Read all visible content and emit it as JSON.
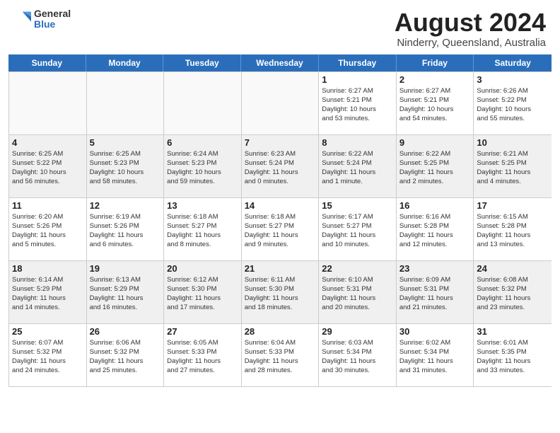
{
  "header": {
    "logo_general": "General",
    "logo_blue": "Blue",
    "main_title": "August 2024",
    "subtitle": "Ninderry, Queensland, Australia"
  },
  "days_of_week": [
    "Sunday",
    "Monday",
    "Tuesday",
    "Wednesday",
    "Thursday",
    "Friday",
    "Saturday"
  ],
  "weeks": [
    [
      {
        "day": "",
        "info": "",
        "empty": true
      },
      {
        "day": "",
        "info": "",
        "empty": true
      },
      {
        "day": "",
        "info": "",
        "empty": true
      },
      {
        "day": "",
        "info": "",
        "empty": true
      },
      {
        "day": "1",
        "info": "Sunrise: 6:27 AM\nSunset: 5:21 PM\nDaylight: 10 hours\nand 53 minutes."
      },
      {
        "day": "2",
        "info": "Sunrise: 6:27 AM\nSunset: 5:21 PM\nDaylight: 10 hours\nand 54 minutes."
      },
      {
        "day": "3",
        "info": "Sunrise: 6:26 AM\nSunset: 5:22 PM\nDaylight: 10 hours\nand 55 minutes."
      }
    ],
    [
      {
        "day": "4",
        "info": "Sunrise: 6:25 AM\nSunset: 5:22 PM\nDaylight: 10 hours\nand 56 minutes.",
        "alt": true
      },
      {
        "day": "5",
        "info": "Sunrise: 6:25 AM\nSunset: 5:23 PM\nDaylight: 10 hours\nand 58 minutes.",
        "alt": true
      },
      {
        "day": "6",
        "info": "Sunrise: 6:24 AM\nSunset: 5:23 PM\nDaylight: 10 hours\nand 59 minutes.",
        "alt": true
      },
      {
        "day": "7",
        "info": "Sunrise: 6:23 AM\nSunset: 5:24 PM\nDaylight: 11 hours\nand 0 minutes.",
        "alt": true
      },
      {
        "day": "8",
        "info": "Sunrise: 6:22 AM\nSunset: 5:24 PM\nDaylight: 11 hours\nand 1 minute.",
        "alt": true
      },
      {
        "day": "9",
        "info": "Sunrise: 6:22 AM\nSunset: 5:25 PM\nDaylight: 11 hours\nand 2 minutes.",
        "alt": true
      },
      {
        "day": "10",
        "info": "Sunrise: 6:21 AM\nSunset: 5:25 PM\nDaylight: 11 hours\nand 4 minutes.",
        "alt": true
      }
    ],
    [
      {
        "day": "11",
        "info": "Sunrise: 6:20 AM\nSunset: 5:26 PM\nDaylight: 11 hours\nand 5 minutes."
      },
      {
        "day": "12",
        "info": "Sunrise: 6:19 AM\nSunset: 5:26 PM\nDaylight: 11 hours\nand 6 minutes."
      },
      {
        "day": "13",
        "info": "Sunrise: 6:18 AM\nSunset: 5:27 PM\nDaylight: 11 hours\nand 8 minutes."
      },
      {
        "day": "14",
        "info": "Sunrise: 6:18 AM\nSunset: 5:27 PM\nDaylight: 11 hours\nand 9 minutes."
      },
      {
        "day": "15",
        "info": "Sunrise: 6:17 AM\nSunset: 5:27 PM\nDaylight: 11 hours\nand 10 minutes."
      },
      {
        "day": "16",
        "info": "Sunrise: 6:16 AM\nSunset: 5:28 PM\nDaylight: 11 hours\nand 12 minutes."
      },
      {
        "day": "17",
        "info": "Sunrise: 6:15 AM\nSunset: 5:28 PM\nDaylight: 11 hours\nand 13 minutes."
      }
    ],
    [
      {
        "day": "18",
        "info": "Sunrise: 6:14 AM\nSunset: 5:29 PM\nDaylight: 11 hours\nand 14 minutes.",
        "alt": true
      },
      {
        "day": "19",
        "info": "Sunrise: 6:13 AM\nSunset: 5:29 PM\nDaylight: 11 hours\nand 16 minutes.",
        "alt": true
      },
      {
        "day": "20",
        "info": "Sunrise: 6:12 AM\nSunset: 5:30 PM\nDaylight: 11 hours\nand 17 minutes.",
        "alt": true
      },
      {
        "day": "21",
        "info": "Sunrise: 6:11 AM\nSunset: 5:30 PM\nDaylight: 11 hours\nand 18 minutes.",
        "alt": true
      },
      {
        "day": "22",
        "info": "Sunrise: 6:10 AM\nSunset: 5:31 PM\nDaylight: 11 hours\nand 20 minutes.",
        "alt": true
      },
      {
        "day": "23",
        "info": "Sunrise: 6:09 AM\nSunset: 5:31 PM\nDaylight: 11 hours\nand 21 minutes.",
        "alt": true
      },
      {
        "day": "24",
        "info": "Sunrise: 6:08 AM\nSunset: 5:32 PM\nDaylight: 11 hours\nand 23 minutes.",
        "alt": true
      }
    ],
    [
      {
        "day": "25",
        "info": "Sunrise: 6:07 AM\nSunset: 5:32 PM\nDaylight: 11 hours\nand 24 minutes."
      },
      {
        "day": "26",
        "info": "Sunrise: 6:06 AM\nSunset: 5:32 PM\nDaylight: 11 hours\nand 25 minutes."
      },
      {
        "day": "27",
        "info": "Sunrise: 6:05 AM\nSunset: 5:33 PM\nDaylight: 11 hours\nand 27 minutes."
      },
      {
        "day": "28",
        "info": "Sunrise: 6:04 AM\nSunset: 5:33 PM\nDaylight: 11 hours\nand 28 minutes."
      },
      {
        "day": "29",
        "info": "Sunrise: 6:03 AM\nSunset: 5:34 PM\nDaylight: 11 hours\nand 30 minutes."
      },
      {
        "day": "30",
        "info": "Sunrise: 6:02 AM\nSunset: 5:34 PM\nDaylight: 11 hours\nand 31 minutes."
      },
      {
        "day": "31",
        "info": "Sunrise: 6:01 AM\nSunset: 5:35 PM\nDaylight: 11 hours\nand 33 minutes."
      }
    ]
  ]
}
